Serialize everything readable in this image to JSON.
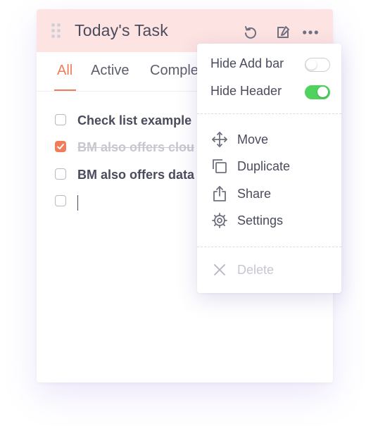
{
  "card": {
    "title": "Today's Task",
    "tabs": [
      {
        "label": "All",
        "active": true
      },
      {
        "label": "Active",
        "active": false
      },
      {
        "label": "Comple",
        "active": false
      }
    ],
    "tasks": [
      {
        "text": "Check list example",
        "checked": false
      },
      {
        "text": "BM also offers clou",
        "checked": true
      },
      {
        "text": "BM also offers data",
        "checked": false
      },
      {
        "text": "",
        "checked": false,
        "editing": true
      }
    ]
  },
  "header_icons": [
    "refresh-icon",
    "edit-note-icon",
    "more-icon"
  ],
  "menu": {
    "toggles": [
      {
        "label": "Hide Add bar",
        "on": false
      },
      {
        "label": "Hide Header",
        "on": true
      }
    ],
    "actions": [
      {
        "label": "Move",
        "icon": "move-icon"
      },
      {
        "label": "Duplicate",
        "icon": "duplicate-icon"
      },
      {
        "label": "Share",
        "icon": "share-icon"
      },
      {
        "label": "Settings",
        "icon": "gear-icon"
      }
    ],
    "delete": {
      "label": "Delete",
      "icon": "close-icon",
      "disabled": true
    }
  },
  "colors": {
    "accent": "#f07c5a",
    "header_bg": "#fde3e1",
    "toggle_on": "#4fd25e",
    "text": "#4a4b5c",
    "muted": "#c6c7cf"
  }
}
